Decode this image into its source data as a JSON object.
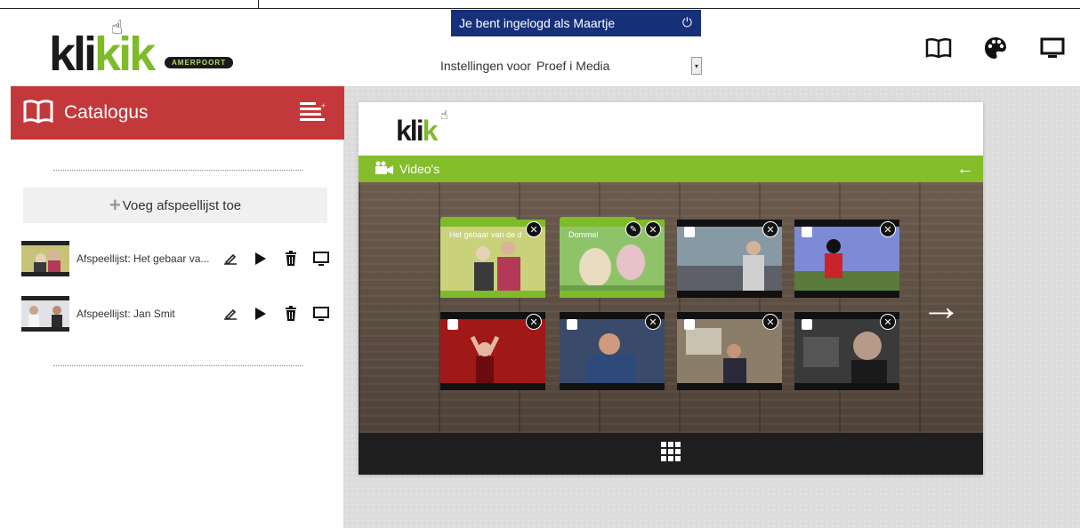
{
  "header": {
    "logo_text_dark": "kli",
    "logo_text_green": "k",
    "logo_text_dark2": "ik",
    "logo_badge": "AMERPOORT",
    "login_text": "Je bent ingelogd als Maartje",
    "settings_label": "Instellingen voor",
    "settings_value": "Proef i Media",
    "icons": [
      "book-icon",
      "palette-icon",
      "monitor-icon"
    ]
  },
  "sidebar": {
    "title": "Catalogus",
    "add_playlist_label": "Voeg afspeellijst toe",
    "playlists": [
      {
        "label": "Afspeellijst: Het gebaar va..."
      },
      {
        "label": "Afspeellijst: Jan Smit"
      }
    ]
  },
  "panel": {
    "logo_dark": "kli",
    "logo_green": "k",
    "section_title": "Video's",
    "tiles": [
      {
        "kind": "folder",
        "caption": "Het gebaar van de d",
        "color": "#c9d17a"
      },
      {
        "kind": "folder",
        "caption": "Dommel",
        "color": "#8fc36a"
      },
      {
        "kind": "video",
        "color": "#6f7a8a"
      },
      {
        "kind": "video",
        "color": "#6a76b8"
      },
      {
        "kind": "video",
        "color": "#a11818"
      },
      {
        "kind": "video",
        "color": "#2d4a7a"
      },
      {
        "kind": "video",
        "color": "#8a7d6a"
      },
      {
        "kind": "video",
        "color": "#3a3a3a"
      }
    ]
  },
  "colors": {
    "brand_red": "#c3383b",
    "brand_green": "#84bd2a",
    "login_blue": "#17307a"
  }
}
